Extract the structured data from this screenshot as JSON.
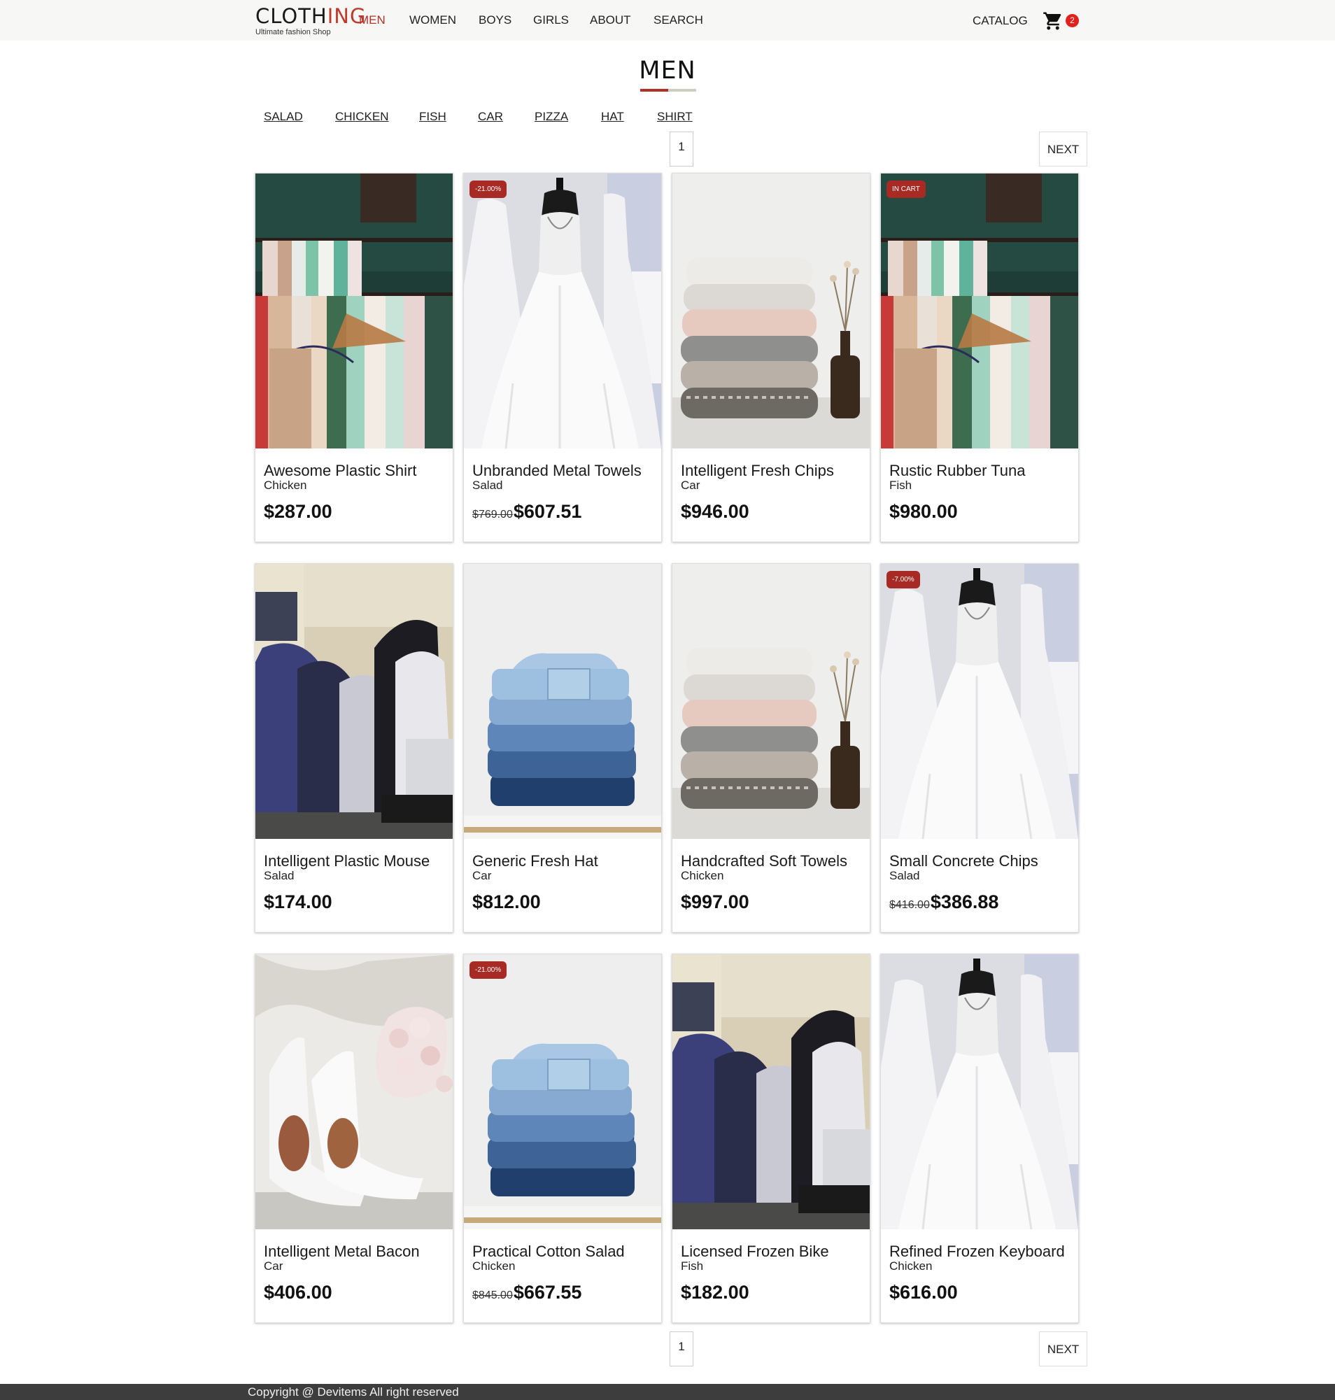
{
  "brand": {
    "name_start": "CLOTH",
    "name_end": "ING",
    "tagline": "Ultimate fashion Shop"
  },
  "nav": {
    "items": [
      "MEN",
      "WOMEN",
      "BOYS",
      "GIRLS",
      "ABOUT",
      "SEARCH"
    ],
    "active": "MEN",
    "catalog": "CATALOG",
    "cart_count": "2"
  },
  "page": {
    "title": "MEN",
    "subcategories": [
      "SALAD",
      "CHICKEN",
      "FISH",
      "CAR",
      "PIZZA",
      "HAT",
      "SHIRT"
    ]
  },
  "pagination": {
    "current_page": "1",
    "next_label": "NEXT"
  },
  "products": [
    {
      "name": "Awesome Plastic Shirt",
      "category": "Chicken",
      "price": "$287.00",
      "old_price": "",
      "badge": "",
      "image": "rack"
    },
    {
      "name": "Unbranded Metal Towels",
      "category": "Salad",
      "price": "$607.51",
      "old_price": "$769.00",
      "badge": "-21.00%",
      "image": "dress"
    },
    {
      "name": "Intelligent Fresh Chips",
      "category": "Car",
      "price": "$946.00",
      "old_price": "",
      "badge": "",
      "image": "sweaters"
    },
    {
      "name": "Rustic Rubber Tuna",
      "category": "Fish",
      "price": "$980.00",
      "old_price": "",
      "badge": "IN CART",
      "image": "rack"
    },
    {
      "name": "Intelligent Plastic Mouse",
      "category": "Salad",
      "price": "$174.00",
      "old_price": "",
      "badge": "",
      "image": "shirts"
    },
    {
      "name": "Generic Fresh Hat",
      "category": "Car",
      "price": "$812.00",
      "old_price": "",
      "badge": "",
      "image": "jeans"
    },
    {
      "name": "Handcrafted Soft Towels",
      "category": "Chicken",
      "price": "$997.00",
      "old_price": "",
      "badge": "",
      "image": "sweaters"
    },
    {
      "name": "Small Concrete Chips",
      "category": "Salad",
      "price": "$386.88",
      "old_price": "$416.00",
      "badge": "-7.00%",
      "image": "dress"
    },
    {
      "name": "Intelligent Metal Bacon",
      "category": "Car",
      "price": "$406.00",
      "old_price": "",
      "badge": "",
      "image": "shoes"
    },
    {
      "name": "Practical Cotton Salad",
      "category": "Chicken",
      "price": "$667.55",
      "old_price": "$845.00",
      "badge": "-21.00%",
      "image": "jeans"
    },
    {
      "name": "Licensed Frozen Bike",
      "category": "Fish",
      "price": "$182.00",
      "old_price": "",
      "badge": "",
      "image": "shirts"
    },
    {
      "name": "Refined Frozen Keyboard",
      "category": "Chicken",
      "price": "$616.00",
      "old_price": "",
      "badge": "",
      "image": "dress"
    }
  ],
  "footer": {
    "text": "Copyright @ Devitems All right reserved"
  },
  "colors": {
    "accent": "#b0322a",
    "badge": "#a82a24",
    "cart_badge": "#e2201c",
    "header_bg": "#f7f8f5",
    "footer_bg": "#3d3d3d"
  }
}
